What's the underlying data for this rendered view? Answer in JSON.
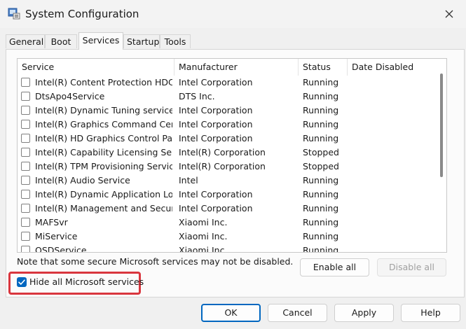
{
  "window": {
    "title": "System Configuration"
  },
  "tabs": [
    {
      "label": "General"
    },
    {
      "label": "Boot"
    },
    {
      "label": "Services"
    },
    {
      "label": "Startup"
    },
    {
      "label": "Tools"
    }
  ],
  "table": {
    "columns": [
      "Service",
      "Manufacturer",
      "Status",
      "Date Disabled"
    ],
    "rows": [
      {
        "service": "Intel(R) Content Protection HDC...",
        "manufacturer": "Intel Corporation",
        "status": "Running",
        "date_disabled": ""
      },
      {
        "service": "DtsApo4Service",
        "manufacturer": "DTS Inc.",
        "status": "Running",
        "date_disabled": ""
      },
      {
        "service": "Intel(R) Dynamic Tuning service",
        "manufacturer": "Intel Corporation",
        "status": "Running",
        "date_disabled": ""
      },
      {
        "service": "Intel(R) Graphics Command Cen...",
        "manufacturer": "Intel Corporation",
        "status": "Running",
        "date_disabled": ""
      },
      {
        "service": "Intel(R) HD Graphics Control Pa...",
        "manufacturer": "Intel Corporation",
        "status": "Running",
        "date_disabled": ""
      },
      {
        "service": "Intel(R) Capability Licensing Ser...",
        "manufacturer": "Intel(R) Corporation",
        "status": "Stopped",
        "date_disabled": ""
      },
      {
        "service": "Intel(R) TPM Provisioning Service",
        "manufacturer": "Intel(R) Corporation",
        "status": "Stopped",
        "date_disabled": ""
      },
      {
        "service": "Intel(R) Audio Service",
        "manufacturer": "Intel",
        "status": "Running",
        "date_disabled": ""
      },
      {
        "service": "Intel(R) Dynamic Application Loa...",
        "manufacturer": "Intel Corporation",
        "status": "Running",
        "date_disabled": ""
      },
      {
        "service": "Intel(R) Management and Secur...",
        "manufacturer": "Intel Corporation",
        "status": "Running",
        "date_disabled": ""
      },
      {
        "service": "MAFSvr",
        "manufacturer": "Xiaomi Inc.",
        "status": "Running",
        "date_disabled": ""
      },
      {
        "service": "MiService",
        "manufacturer": "Xiaomi Inc.",
        "status": "Running",
        "date_disabled": ""
      },
      {
        "service": "OSDService",
        "manufacturer": "Xiaomi Inc.",
        "status": "Running",
        "date_disabled": ""
      }
    ]
  },
  "note": "Note that some secure Microsoft services may not be disabled.",
  "buttons": {
    "enable_all": "Enable all",
    "disable_all": "Disable all",
    "ok": "OK",
    "cancel": "Cancel",
    "apply": "Apply",
    "help": "Help"
  },
  "hide_ms": {
    "label": "Hide all Microsoft services",
    "checked": true
  },
  "icons": {
    "app": "system-configuration-icon",
    "close": "close-icon",
    "check": "checkmark-icon"
  },
  "colors": {
    "accent": "#0067c0",
    "highlight": "#d9363e"
  }
}
